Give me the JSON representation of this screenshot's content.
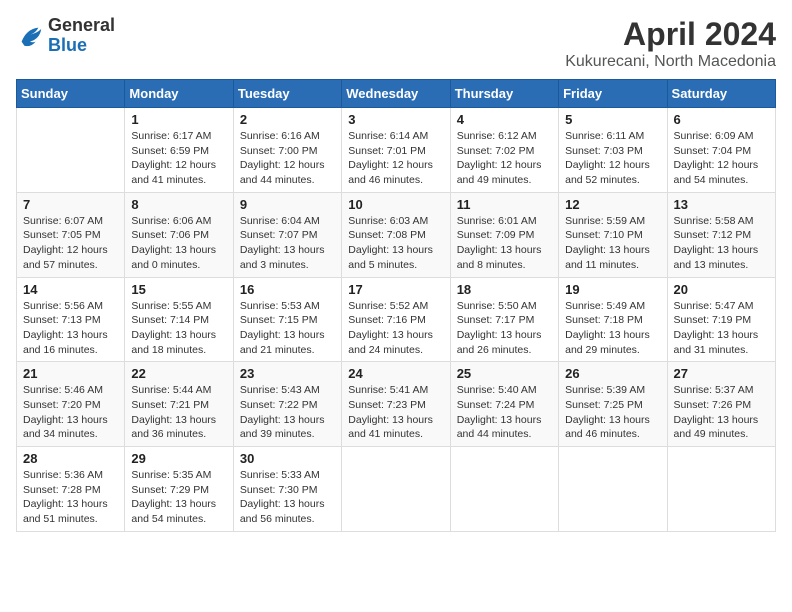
{
  "header": {
    "logo_general": "General",
    "logo_blue": "Blue",
    "month": "April 2024",
    "location": "Kukurecani, North Macedonia"
  },
  "calendar": {
    "days_of_week": [
      "Sunday",
      "Monday",
      "Tuesday",
      "Wednesday",
      "Thursday",
      "Friday",
      "Saturday"
    ],
    "weeks": [
      [
        {
          "date": "",
          "info": ""
        },
        {
          "date": "1",
          "info": "Sunrise: 6:17 AM\nSunset: 6:59 PM\nDaylight: 12 hours\nand 41 minutes."
        },
        {
          "date": "2",
          "info": "Sunrise: 6:16 AM\nSunset: 7:00 PM\nDaylight: 12 hours\nand 44 minutes."
        },
        {
          "date": "3",
          "info": "Sunrise: 6:14 AM\nSunset: 7:01 PM\nDaylight: 12 hours\nand 46 minutes."
        },
        {
          "date": "4",
          "info": "Sunrise: 6:12 AM\nSunset: 7:02 PM\nDaylight: 12 hours\nand 49 minutes."
        },
        {
          "date": "5",
          "info": "Sunrise: 6:11 AM\nSunset: 7:03 PM\nDaylight: 12 hours\nand 52 minutes."
        },
        {
          "date": "6",
          "info": "Sunrise: 6:09 AM\nSunset: 7:04 PM\nDaylight: 12 hours\nand 54 minutes."
        }
      ],
      [
        {
          "date": "7",
          "info": "Sunrise: 6:07 AM\nSunset: 7:05 PM\nDaylight: 12 hours\nand 57 minutes."
        },
        {
          "date": "8",
          "info": "Sunrise: 6:06 AM\nSunset: 7:06 PM\nDaylight: 13 hours\nand 0 minutes."
        },
        {
          "date": "9",
          "info": "Sunrise: 6:04 AM\nSunset: 7:07 PM\nDaylight: 13 hours\nand 3 minutes."
        },
        {
          "date": "10",
          "info": "Sunrise: 6:03 AM\nSunset: 7:08 PM\nDaylight: 13 hours\nand 5 minutes."
        },
        {
          "date": "11",
          "info": "Sunrise: 6:01 AM\nSunset: 7:09 PM\nDaylight: 13 hours\nand 8 minutes."
        },
        {
          "date": "12",
          "info": "Sunrise: 5:59 AM\nSunset: 7:10 PM\nDaylight: 13 hours\nand 11 minutes."
        },
        {
          "date": "13",
          "info": "Sunrise: 5:58 AM\nSunset: 7:12 PM\nDaylight: 13 hours\nand 13 minutes."
        }
      ],
      [
        {
          "date": "14",
          "info": "Sunrise: 5:56 AM\nSunset: 7:13 PM\nDaylight: 13 hours\nand 16 minutes."
        },
        {
          "date": "15",
          "info": "Sunrise: 5:55 AM\nSunset: 7:14 PM\nDaylight: 13 hours\nand 18 minutes."
        },
        {
          "date": "16",
          "info": "Sunrise: 5:53 AM\nSunset: 7:15 PM\nDaylight: 13 hours\nand 21 minutes."
        },
        {
          "date": "17",
          "info": "Sunrise: 5:52 AM\nSunset: 7:16 PM\nDaylight: 13 hours\nand 24 minutes."
        },
        {
          "date": "18",
          "info": "Sunrise: 5:50 AM\nSunset: 7:17 PM\nDaylight: 13 hours\nand 26 minutes."
        },
        {
          "date": "19",
          "info": "Sunrise: 5:49 AM\nSunset: 7:18 PM\nDaylight: 13 hours\nand 29 minutes."
        },
        {
          "date": "20",
          "info": "Sunrise: 5:47 AM\nSunset: 7:19 PM\nDaylight: 13 hours\nand 31 minutes."
        }
      ],
      [
        {
          "date": "21",
          "info": "Sunrise: 5:46 AM\nSunset: 7:20 PM\nDaylight: 13 hours\nand 34 minutes."
        },
        {
          "date": "22",
          "info": "Sunrise: 5:44 AM\nSunset: 7:21 PM\nDaylight: 13 hours\nand 36 minutes."
        },
        {
          "date": "23",
          "info": "Sunrise: 5:43 AM\nSunset: 7:22 PM\nDaylight: 13 hours\nand 39 minutes."
        },
        {
          "date": "24",
          "info": "Sunrise: 5:41 AM\nSunset: 7:23 PM\nDaylight: 13 hours\nand 41 minutes."
        },
        {
          "date": "25",
          "info": "Sunrise: 5:40 AM\nSunset: 7:24 PM\nDaylight: 13 hours\nand 44 minutes."
        },
        {
          "date": "26",
          "info": "Sunrise: 5:39 AM\nSunset: 7:25 PM\nDaylight: 13 hours\nand 46 minutes."
        },
        {
          "date": "27",
          "info": "Sunrise: 5:37 AM\nSunset: 7:26 PM\nDaylight: 13 hours\nand 49 minutes."
        }
      ],
      [
        {
          "date": "28",
          "info": "Sunrise: 5:36 AM\nSunset: 7:28 PM\nDaylight: 13 hours\nand 51 minutes."
        },
        {
          "date": "29",
          "info": "Sunrise: 5:35 AM\nSunset: 7:29 PM\nDaylight: 13 hours\nand 54 minutes."
        },
        {
          "date": "30",
          "info": "Sunrise: 5:33 AM\nSunset: 7:30 PM\nDaylight: 13 hours\nand 56 minutes."
        },
        {
          "date": "",
          "info": ""
        },
        {
          "date": "",
          "info": ""
        },
        {
          "date": "",
          "info": ""
        },
        {
          "date": "",
          "info": ""
        }
      ]
    ]
  }
}
